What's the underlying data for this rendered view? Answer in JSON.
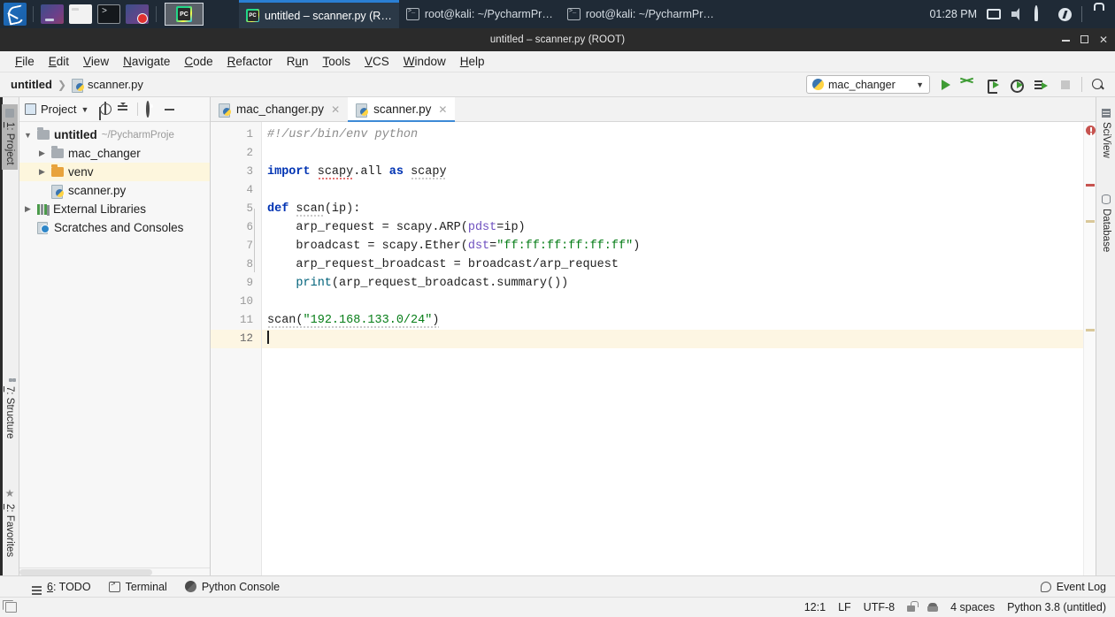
{
  "taskbar": {
    "launcher_icon": "kali-dragon-icon",
    "quick_launch": [
      {
        "name": "files-manager-icon",
        "label": ""
      },
      {
        "name": "file-browser-icon",
        "label": ""
      },
      {
        "name": "terminal-icon",
        "label": ""
      },
      {
        "name": "screen-recorder-icon",
        "label": ""
      }
    ],
    "active_launcher": {
      "name": "pycharm-launcher-icon",
      "label": ""
    },
    "windows": [
      {
        "label": "untitled – scanner.py (R…",
        "icon": "pycharm-icon",
        "active": true
      },
      {
        "label": "root@kali: ~/PycharmPr…",
        "icon": "terminal-icon",
        "active": false
      },
      {
        "label": "root@kali: ~/PycharmPr…",
        "icon": "terminal-icon",
        "active": false
      }
    ],
    "clock": "01:28 PM",
    "tray": [
      "display-icon",
      "volume-icon",
      "notification-bell-icon",
      "power-icon",
      "lock-icon"
    ]
  },
  "window": {
    "title": "untitled – scanner.py (ROOT)",
    "buttons": {
      "minimize": "minimize-button",
      "maximize": "maximize-button",
      "close": "✕"
    }
  },
  "menubar": [
    {
      "pre": "",
      "mn": "F",
      "post": "ile"
    },
    {
      "pre": "",
      "mn": "E",
      "post": "dit"
    },
    {
      "pre": "",
      "mn": "V",
      "post": "iew"
    },
    {
      "pre": "",
      "mn": "N",
      "post": "avigate"
    },
    {
      "pre": "",
      "mn": "C",
      "post": "ode"
    },
    {
      "pre": "",
      "mn": "R",
      "post": "efactor"
    },
    {
      "pre": "R",
      "mn": "u",
      "post": "n"
    },
    {
      "pre": "",
      "mn": "T",
      "post": "ools"
    },
    {
      "pre": "",
      "mn": "VCS",
      "post": ""
    },
    {
      "pre": "",
      "mn": "W",
      "post": "indow"
    },
    {
      "pre": "",
      "mn": "H",
      "post": "elp"
    }
  ],
  "navbar": {
    "breadcrumbs": [
      {
        "label": "untitled",
        "bold": true,
        "icon": ""
      },
      {
        "label": "scanner.py",
        "bold": false,
        "icon": "python-file-icon"
      }
    ],
    "separator": "❯",
    "run_config": {
      "label": "mac_changer",
      "icon": "python-icon",
      "caret": "▼"
    },
    "actions": [
      {
        "name": "run-button"
      },
      {
        "name": "debug-button"
      },
      {
        "name": "run-with-coverage-button"
      },
      {
        "name": "profile-button"
      },
      {
        "name": "run-to-cursor-button"
      },
      {
        "name": "stop-button"
      },
      {
        "name": "search-everywhere-button"
      }
    ]
  },
  "left_strip": [
    {
      "pre": "1",
      "mn": "1",
      "label": ": Project",
      "icon": "project-icon",
      "active": true
    },
    {
      "pre": "7",
      "mn": "7",
      "label": ": Structure",
      "icon": "structure-icon",
      "active": false
    },
    {
      "pre": "2",
      "mn": "2",
      "label": ": Favorites",
      "icon": "star-icon",
      "active": false
    }
  ],
  "right_strip": [
    {
      "label": "SciView",
      "icon": "sciview-icon"
    },
    {
      "label": "Database",
      "icon": "database-icon"
    }
  ],
  "project_panel": {
    "title": "Project",
    "title_caret": "▼",
    "header_actions": [
      "locate-icon",
      "collapse-all-icon",
      "settings-gear-icon",
      "hide-icon"
    ],
    "tree": [
      {
        "label": "untitled",
        "path": "~/PycharmProje",
        "icon": "folder-icon",
        "arrow": "down",
        "indent": 0,
        "bold": true,
        "selected": false
      },
      {
        "label": "mac_changer",
        "path": "",
        "icon": "folder-icon",
        "arrow": "right",
        "indent": 1,
        "bold": false,
        "selected": false
      },
      {
        "label": "venv",
        "path": "",
        "icon": "folder-orange-icon",
        "arrow": "right",
        "indent": 1,
        "bold": false,
        "selected": true
      },
      {
        "label": "scanner.py",
        "path": "",
        "icon": "python-file-icon",
        "arrow": "none",
        "indent": 1,
        "bold": false,
        "selected": false
      },
      {
        "label": "External Libraries",
        "path": "",
        "icon": "libraries-icon",
        "arrow": "right",
        "indent": 0,
        "bold": false,
        "selected": false
      },
      {
        "label": "Scratches and Consoles",
        "path": "",
        "icon": "scratches-icon",
        "arrow": "none",
        "indent": 0,
        "bold": false,
        "selected": false
      }
    ]
  },
  "editor": {
    "tabs": [
      {
        "label": "mac_changer.py",
        "icon": "python-file-icon",
        "active": false,
        "close": "✕"
      },
      {
        "label": "scanner.py",
        "icon": "python-file-icon",
        "active": true,
        "close": "✕"
      }
    ],
    "line_numbers": [
      "1",
      "2",
      "3",
      "4",
      "5",
      "6",
      "7",
      "8",
      "9",
      "10",
      "11",
      "12"
    ],
    "current_line": 12,
    "code_lines": [
      {
        "n": 1,
        "text": "#!/usr/bin/env python"
      },
      {
        "n": 2,
        "text": ""
      },
      {
        "n": 3,
        "text": "import scapy.all as scapy"
      },
      {
        "n": 4,
        "text": ""
      },
      {
        "n": 5,
        "text": "def scan(ip):"
      },
      {
        "n": 6,
        "text": "    arp_request = scapy.ARP(pdst=ip)"
      },
      {
        "n": 7,
        "text": "    broadcast = scapy.Ether(dst=\"ff:ff:ff:ff:ff:ff\")"
      },
      {
        "n": 8,
        "text": "    arp_request_broadcast = broadcast/arp_request"
      },
      {
        "n": 9,
        "text": "    print(arp_request_broadcast.summary())"
      },
      {
        "n": 10,
        "text": ""
      },
      {
        "n": 11,
        "text": "scan(\"192.168.133.0/24\")"
      },
      {
        "n": 12,
        "text": ""
      }
    ],
    "error_marker": "error-indicator"
  },
  "bottom_strip": {
    "tabs": [
      {
        "pre": "",
        "mn": "6",
        "label": ": TODO",
        "icon": "todo-icon"
      },
      {
        "pre": "",
        "mn": "",
        "label": "Terminal",
        "icon": "terminal-icon"
      },
      {
        "pre": "",
        "mn": "",
        "label": "Python Console",
        "icon": "python-console-icon"
      }
    ],
    "event_log": {
      "label": "Event Log",
      "icon": "event-log-icon"
    }
  },
  "statusbar": {
    "left_icon": "toggle-tool-windows-icon",
    "position": "12:1",
    "line_separator": "LF",
    "encoding": "UTF-8",
    "lock_icon": "read-only-lock-icon",
    "git_icon": "git-branch-icon",
    "indent": "4 spaces",
    "interpreter": "Python 3.8 (untitled)"
  }
}
